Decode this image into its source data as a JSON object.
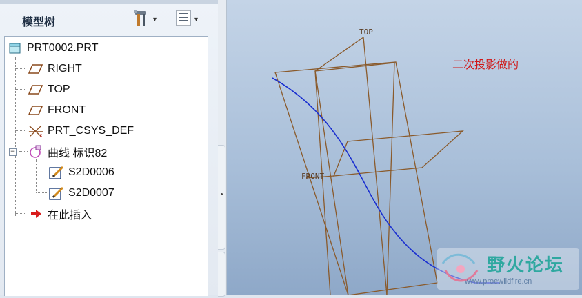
{
  "model_tree": {
    "title": "模型树",
    "settings_caret": "▾",
    "show_caret": "▾",
    "items": [
      {
        "label": "PRT0002.PRT",
        "icon": "part-icon"
      },
      {
        "label": "RIGHT",
        "icon": "datum-plane-icon"
      },
      {
        "label": "TOP",
        "icon": "datum-plane-icon"
      },
      {
        "label": "FRONT",
        "icon": "datum-plane-icon"
      },
      {
        "label": "PRT_CSYS_DEF",
        "icon": "coordinate-system-icon"
      },
      {
        "label": "曲线 标识82",
        "icon": "curve-feature-icon"
      },
      {
        "label": "S2D0006",
        "icon": "sketch-icon"
      },
      {
        "label": "S2D0007",
        "icon": "sketch-icon"
      },
      {
        "label": "在此插入",
        "icon": "insert-here-arrow-icon"
      }
    ],
    "expander": "−"
  },
  "graphics": {
    "plane_labels": {
      "top": "TOP",
      "front": "FRONT"
    },
    "annotation": "二次投影做的",
    "datum_color": "#8a5a2b",
    "curve_color": "#1a2fd0",
    "note_color": "#d01818"
  },
  "watermark": {
    "title": "野火论坛",
    "url": "www.proewildfire.cn"
  }
}
